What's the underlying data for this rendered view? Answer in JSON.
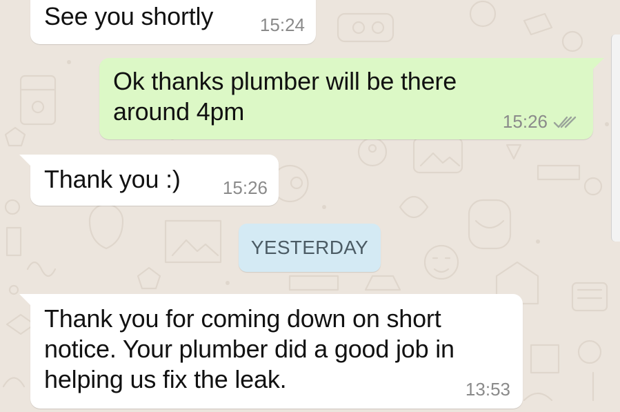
{
  "colors": {
    "wallpaper": "#ece5dd",
    "incoming_bubble": "#ffffff",
    "outgoing_bubble": "#dcf8c6",
    "date_chip": "#d4eaf4",
    "read_ticks": "#9aa39a"
  },
  "messages": [
    {
      "direction": "incoming",
      "text": "See you shortly",
      "time": "15:24"
    },
    {
      "direction": "outgoing",
      "text": "Ok thanks plumber will be there around 4pm",
      "time": "15:26",
      "status_icon": "double-check-icon"
    },
    {
      "direction": "incoming",
      "text": "Thank you :)",
      "time": "15:26"
    },
    {
      "direction": "incoming",
      "text": "Thank you for coming down on short notice. Your plumber did a good job in helping us fix the leak.",
      "time": "13:53"
    }
  ],
  "day_separator": {
    "label": "YESTERDAY"
  }
}
